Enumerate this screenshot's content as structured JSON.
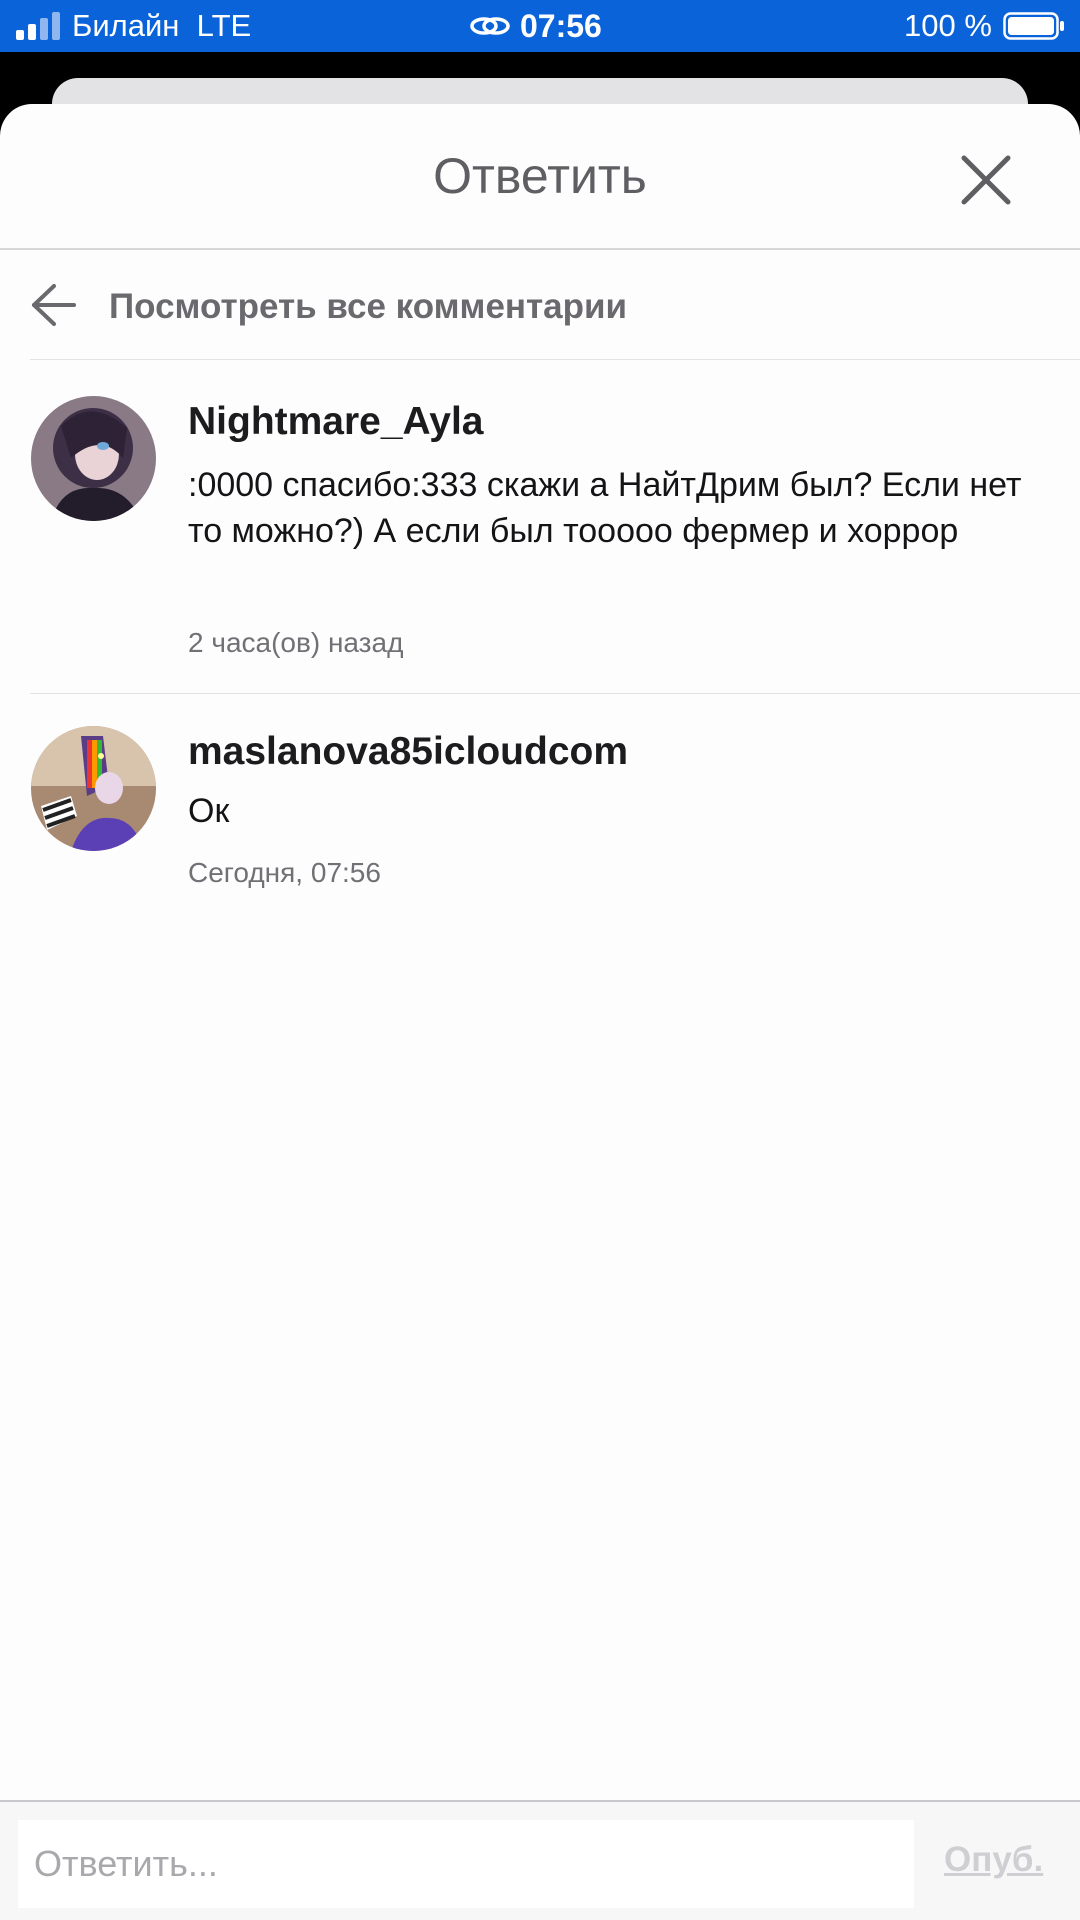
{
  "status_bar": {
    "carrier": "Билайн",
    "network": "LTE",
    "time": "07:56",
    "battery_percent": "100 %",
    "icons": [
      "signal-bars-icon",
      "link-icon",
      "battery-icon"
    ],
    "background_color": "#0b63d9"
  },
  "sheet": {
    "title": "Ответить",
    "close_icon": "close-icon"
  },
  "back_row": {
    "label": "Посмотреть все комментарии",
    "icon": "arrow-left-icon"
  },
  "comments": [
    {
      "author": "Nightmare_Ayla",
      "text": ":0000 спасибо:333 скажи а НайтДрим был? Если нет то можно?) А если был тооооо фермер и хоррор",
      "time": "2 часа(ов) назад",
      "avatar": "user-avatar"
    },
    {
      "author": "maslanova85icloudcom",
      "text": "Ок",
      "time": "Сегодня, 07:56",
      "avatar": "user-avatar"
    }
  ],
  "composer": {
    "placeholder": "Ответить...",
    "value": "",
    "publish_label": "Опуб."
  }
}
